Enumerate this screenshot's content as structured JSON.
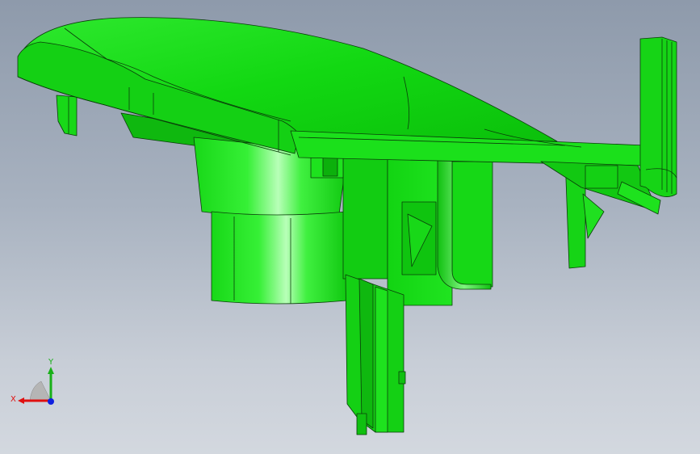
{
  "viewport": {
    "background_top": "#8e9aab",
    "background_bottom": "#d3d8df",
    "model_color": "#16e016",
    "edge_color": "#0a3d0a"
  },
  "triad": {
    "x_label": "X",
    "y_label": "Y",
    "x_color": "#e01010",
    "y_color": "#18b018",
    "z_color": "#1020e0"
  }
}
